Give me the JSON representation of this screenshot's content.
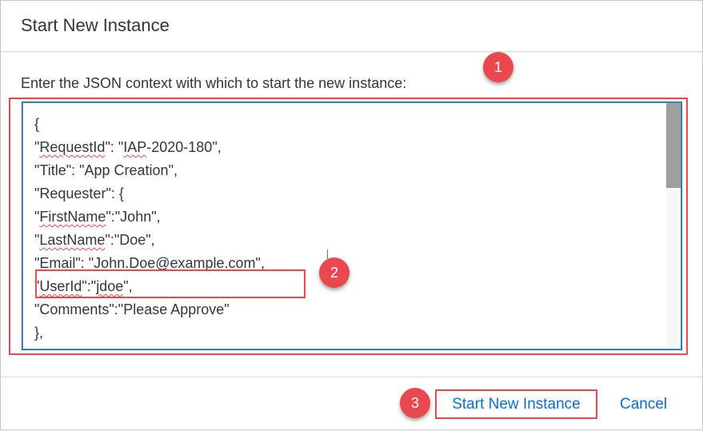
{
  "dialog": {
    "title": "Start New Instance",
    "prompt": "Enter the JSON context with which to start the new instance:"
  },
  "editor": {
    "lines": [
      "{",
      "\"RequestId\": \"IAP-2020-180\",",
      "\"Title\": \"App Creation\",",
      "\"Requester\": {",
      "\"FirstName\":\"John\",",
      "\"LastName\":\"Doe\",",
      "\"Email\": \"John.Doe@example.com\",",
      "\"UserId\":\"jdoe\",",
      "\"Comments\":\"Please Approve\"",
      "},"
    ],
    "misspelled_words": [
      "RequestId",
      "IAP",
      "FirstName",
      "LastName",
      "UserId",
      "jdoe"
    ]
  },
  "annotations": {
    "step1": "1",
    "step2": "2",
    "step3": "3"
  },
  "footer": {
    "start_label": "Start New Instance",
    "cancel_label": "Cancel"
  },
  "colors": {
    "accent": "#0a6ed1",
    "annotation": "#e8484e",
    "text": "#32363a"
  }
}
